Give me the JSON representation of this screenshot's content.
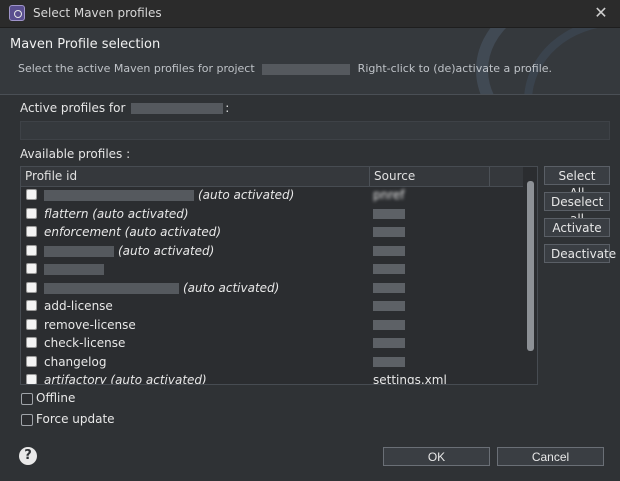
{
  "window": {
    "title": "Select Maven profiles"
  },
  "header": {
    "title": "Maven Profile selection",
    "desc_prefix": "Select the active Maven profiles for project",
    "desc_suffix": "Right-click to (de)activate a profile."
  },
  "active_profiles": {
    "label_prefix": "Active profiles for",
    "label_suffix": ":"
  },
  "available_profiles": {
    "label": "Available profiles :",
    "columns": [
      "Profile id",
      "Source"
    ],
    "rows": [
      {
        "id": "",
        "suffix": "(auto activated)",
        "source": "pnref",
        "italic": true,
        "redact_w": 150
      },
      {
        "id": "flattern (auto activated)",
        "suffix": "",
        "source": "",
        "italic": true,
        "redact_w": 0
      },
      {
        "id": "enforcement (auto activated)",
        "suffix": "",
        "source": "",
        "italic": true,
        "redact_w": 0
      },
      {
        "id": "",
        "suffix": "(auto activated)",
        "source": "",
        "italic": true,
        "redact_w": 70
      },
      {
        "id": "",
        "suffix": "",
        "source": "",
        "italic": false,
        "redact_w": 60
      },
      {
        "id": "",
        "suffix": "(auto activated)",
        "source": "",
        "italic": true,
        "redact_w": 135
      },
      {
        "id": "add-license",
        "suffix": "",
        "source": "",
        "italic": false,
        "redact_w": 0
      },
      {
        "id": "remove-license",
        "suffix": "",
        "source": "",
        "italic": false,
        "redact_w": 0
      },
      {
        "id": "check-license",
        "suffix": "",
        "source": "",
        "italic": false,
        "redact_w": 0
      },
      {
        "id": "changelog",
        "suffix": "",
        "source": "",
        "italic": false,
        "redact_w": 0
      },
      {
        "id": "artifactory (auto activated)",
        "suffix": "",
        "source": "settings.xml",
        "italic": true,
        "redact_w": 0
      }
    ]
  },
  "side_buttons": {
    "select_all": "Select All",
    "deselect_all": "Deselect all",
    "activate": "Activate",
    "deactivate": "Deactivate"
  },
  "options": {
    "offline": "Offline",
    "force_update": "Force update"
  },
  "footer": {
    "ok": "OK",
    "cancel": "Cancel",
    "help": "?"
  },
  "icons": {
    "app": "eclipse-icon",
    "close": "close-icon",
    "help": "help-icon"
  }
}
